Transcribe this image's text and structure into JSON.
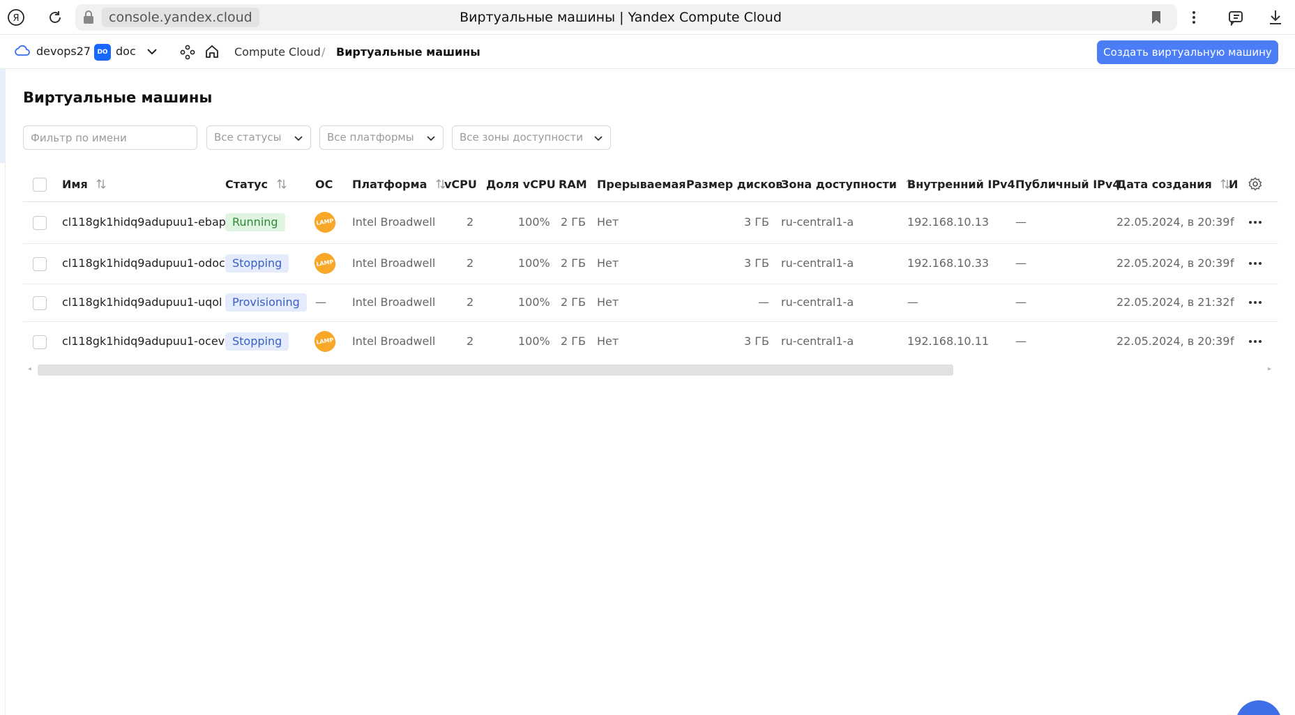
{
  "browser": {
    "host": "console.yandex.cloud",
    "tab_title": "Виртуальные машины | Yandex Compute Cloud"
  },
  "header": {
    "cloud": "devops27",
    "folder_badge": "DO",
    "folder": "doc",
    "breadcrumb_service": "Compute Cloud",
    "breadcrumb_separator": "/",
    "breadcrumb_current": "Виртуальные машины",
    "create_button": "Создать виртуальную машину"
  },
  "page": {
    "title": "Виртуальные машины",
    "filter_placeholder": "Фильтр по имени",
    "status_select": "Все статусы",
    "platform_select": "Все платформы",
    "zone_select": "Все зоны доступности"
  },
  "table": {
    "columns": [
      "Имя",
      "Статус",
      "ОС",
      "Платформа",
      "vCPU",
      "Доля vCPU",
      "RAM",
      "Прерываемая",
      "Размер дисков",
      "Зона доступности",
      "Внутренний IPv4",
      "Публичный IPv4",
      "Дата создания",
      "И"
    ],
    "rows": [
      {
        "name": "cl118gk1hidq9adupuu1-ebap",
        "status": "Running",
        "os": "LAMP",
        "platform": "Intel Broadwell",
        "vcpu": "2",
        "vcpu_share": "100%",
        "ram": "2 ГБ",
        "preemptible": "Нет",
        "disk": "3 ГБ",
        "zone": "ru-central1-a",
        "ipv4": "192.168.10.13",
        "public_ipv4": "—",
        "created": "22.05.2024, в 20:39",
        "extra": "f"
      },
      {
        "name": "cl118gk1hidq9adupuu1-odoc",
        "status": "Stopping",
        "os": "LAMP",
        "platform": "Intel Broadwell",
        "vcpu": "2",
        "vcpu_share": "100%",
        "ram": "2 ГБ",
        "preemptible": "Нет",
        "disk": "3 ГБ",
        "zone": "ru-central1-a",
        "ipv4": "192.168.10.33",
        "public_ipv4": "—",
        "created": "22.05.2024, в 20:39",
        "extra": "f"
      },
      {
        "name": "cl118gk1hidq9adupuu1-uqol",
        "status": "Provisioning",
        "os": "—",
        "platform": "Intel Broadwell",
        "vcpu": "2",
        "vcpu_share": "100%",
        "ram": "2 ГБ",
        "preemptible": "Нет",
        "disk": "—",
        "zone": "ru-central1-a",
        "ipv4": "—",
        "public_ipv4": "—",
        "created": "22.05.2024, в 21:32",
        "extra": "f"
      },
      {
        "name": "cl118gk1hidq9adupuu1-ocev",
        "status": "Stopping",
        "os": "LAMP",
        "platform": "Intel Broadwell",
        "vcpu": "2",
        "vcpu_share": "100%",
        "ram": "2 ГБ",
        "preemptible": "Нет",
        "disk": "3 ГБ",
        "zone": "ru-central1-a",
        "ipv4": "192.168.10.11",
        "public_ipv4": "—",
        "created": "22.05.2024, в 20:39",
        "extra": "f"
      }
    ]
  },
  "colors": {
    "accent": "#4a7df6",
    "running_bg": "#dff5e1",
    "running_fg": "#2e8a37",
    "stopping_bg": "#e3ebfc",
    "stopping_fg": "#3a5fc8",
    "lamp": "#f8a728"
  },
  "icons": {
    "browser": [
      "yandex-logo-icon",
      "reload-icon",
      "lock-icon",
      "bookmark-icon",
      "kebab-menu-icon",
      "sidebar-icon",
      "download-icon"
    ],
    "header": [
      "cloud-icon",
      "chevron-down-icon",
      "services-icon",
      "home-icon"
    ],
    "table": [
      "sort-icon",
      "settings-gear-icon",
      "more-dots-icon"
    ]
  }
}
